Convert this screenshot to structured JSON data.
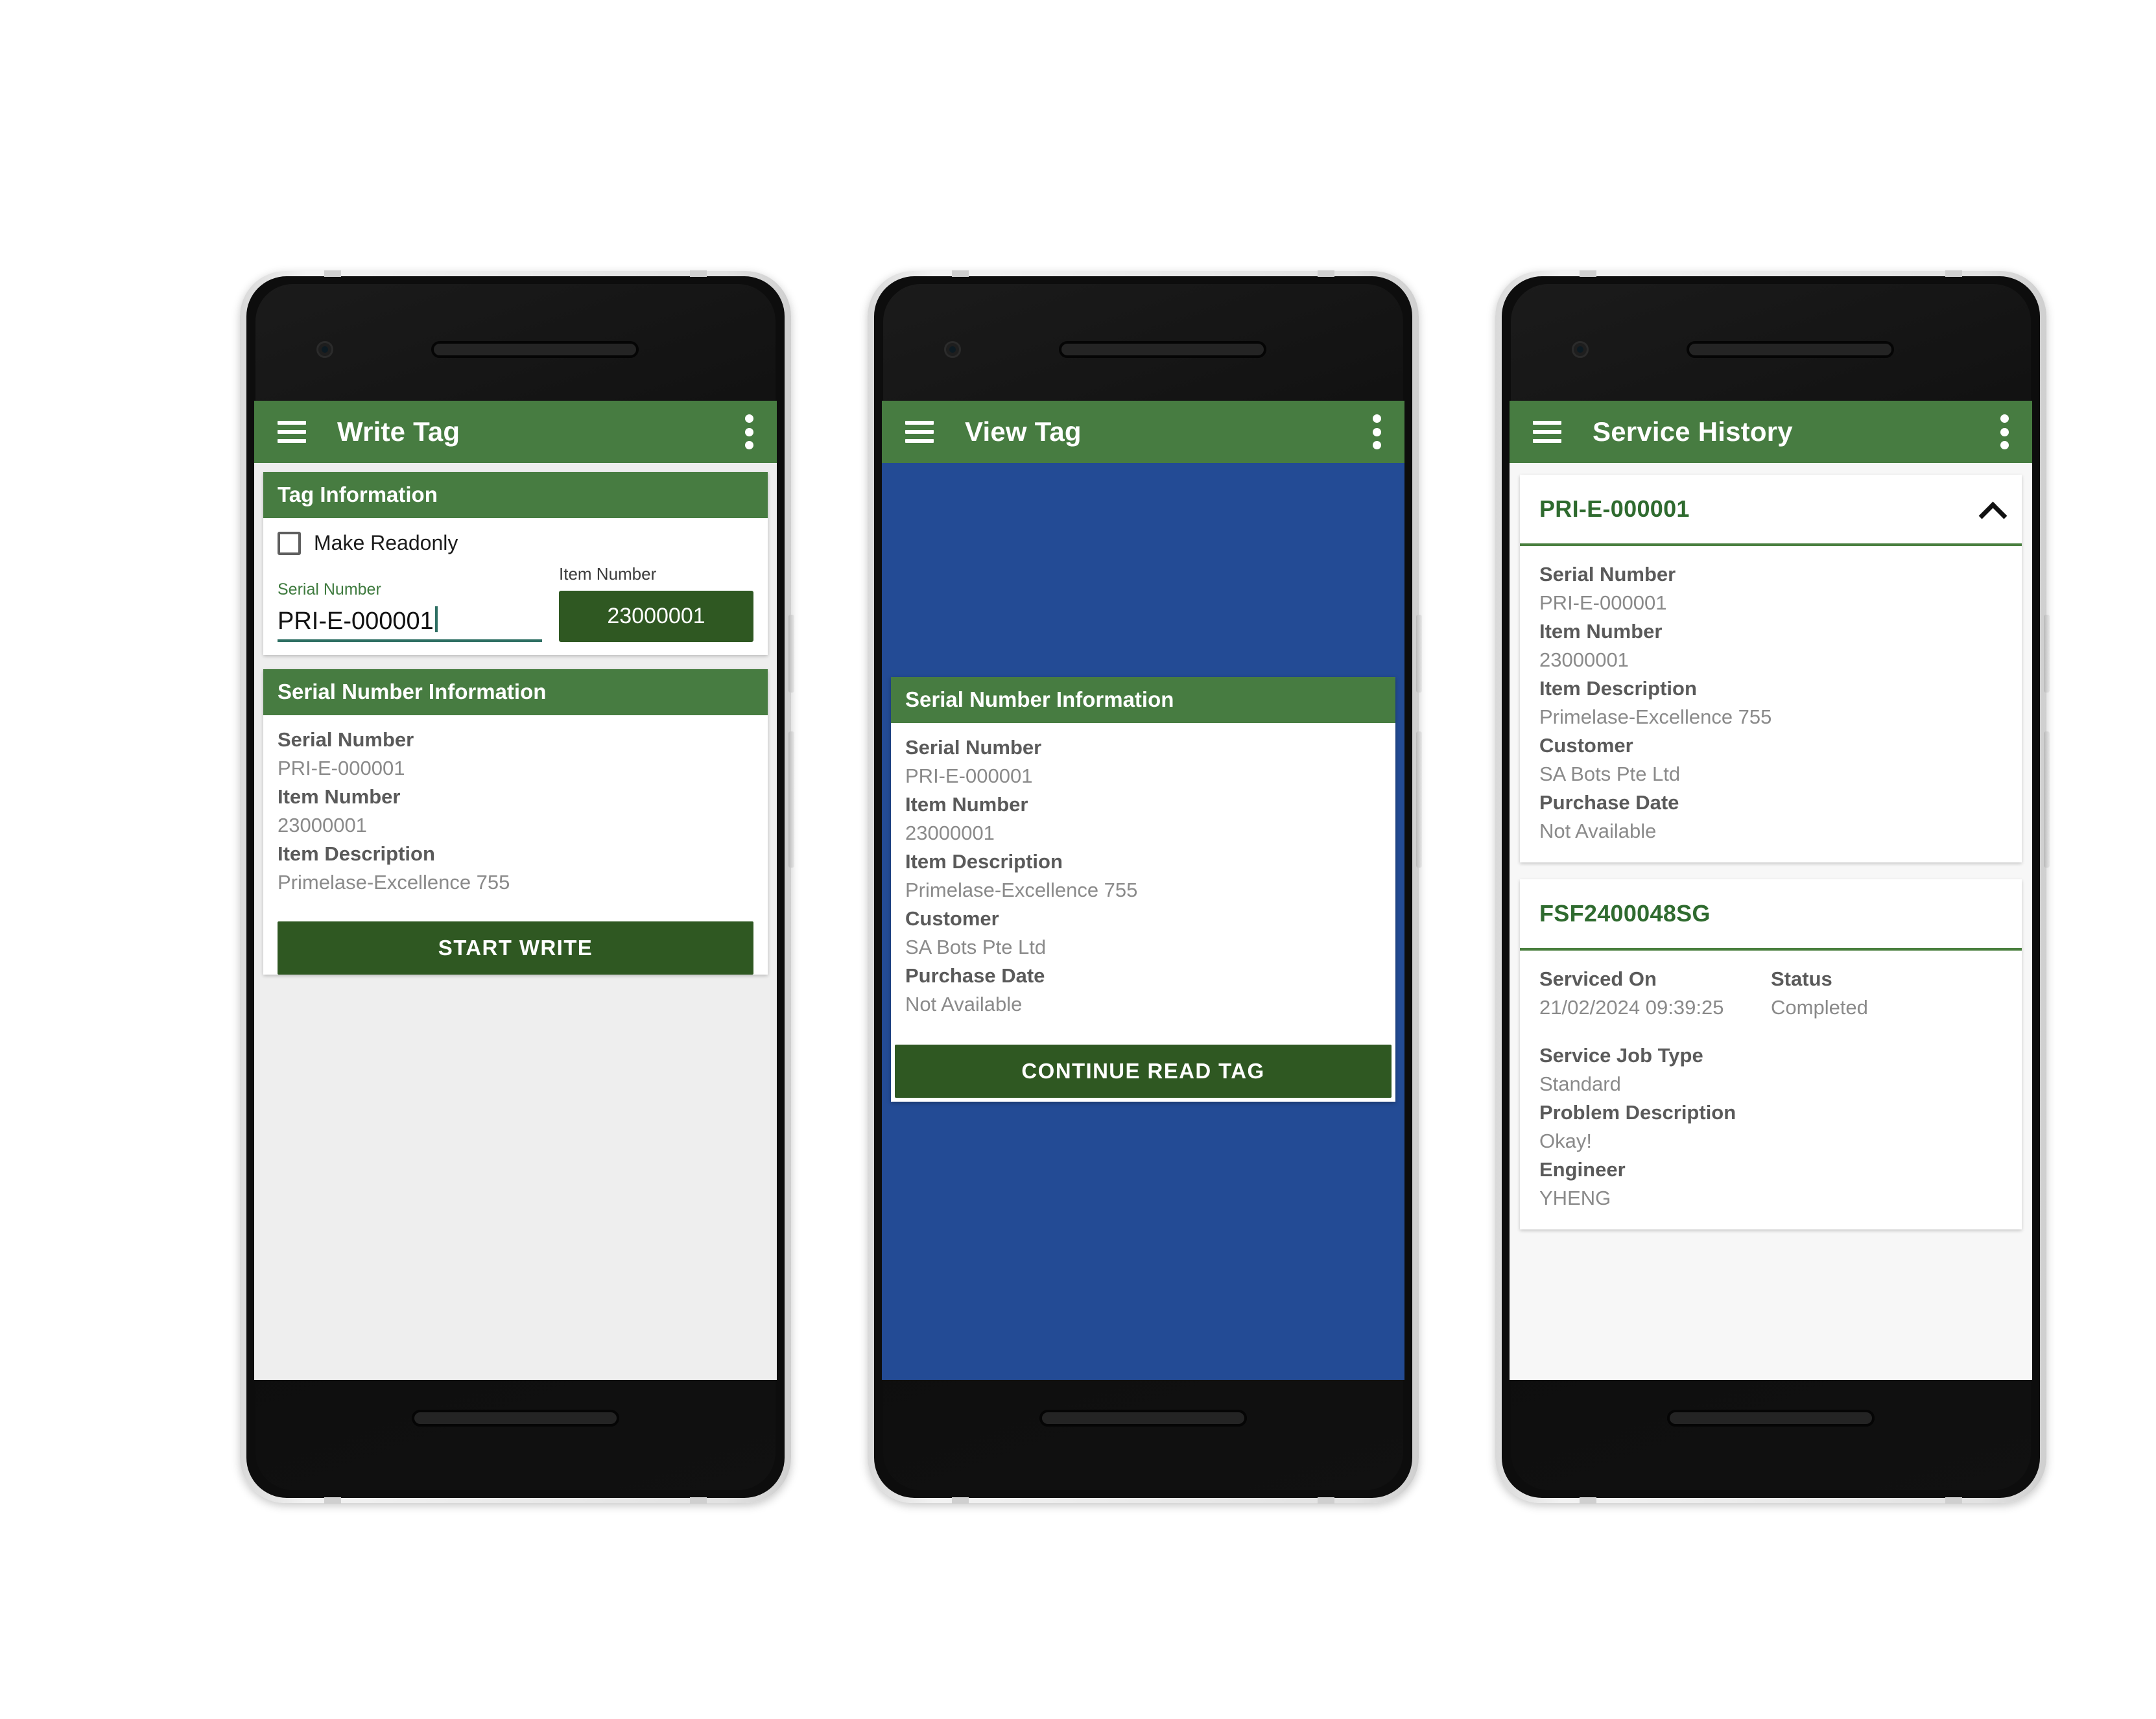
{
  "phones": [
    {
      "id": "write-tag",
      "appbar": {
        "title": "Write Tag",
        "menu_icon": "hamburger-icon",
        "overflow_icon": "kebab-icon"
      },
      "cards": [
        {
          "header": "Tag Information",
          "checkbox_label": "Make Readonly",
          "checkbox_checked": false,
          "serial_field": {
            "label": "Serial Number",
            "value": "PRI-E-000001"
          },
          "item_field": {
            "label": "Item Number",
            "value": "23000001"
          }
        },
        {
          "header": "Serial Number Information",
          "rows": [
            {
              "label": "Serial Number",
              "value": "PRI-E-000001"
            },
            {
              "label": "Item Number",
              "value": "23000001"
            },
            {
              "label": "Item Description",
              "value": "Primelase-Excellence 755"
            }
          ],
          "button": "START WRITE"
        }
      ]
    },
    {
      "id": "view-tag",
      "appbar": {
        "title": "View Tag",
        "menu_icon": "hamburger-icon",
        "overflow_icon": "kebab-icon"
      },
      "background_color": "#234b95",
      "sheet": {
        "header": "Serial Number Information",
        "rows": [
          {
            "label": "Serial Number",
            "value": "PRI-E-000001"
          },
          {
            "label": "Item Number",
            "value": "23000001"
          },
          {
            "label": "Item Description",
            "value": "Primelase-Excellence 755"
          },
          {
            "label": "Customer",
            "value": "SA Bots Pte Ltd"
          },
          {
            "label": "Purchase Date",
            "value": "Not Available"
          }
        ],
        "button": "CONTINUE READ TAG"
      }
    },
    {
      "id": "service-history",
      "appbar": {
        "title": "Service History",
        "menu_icon": "hamburger-icon",
        "overflow_icon": "kebab-icon"
      },
      "serial_card": {
        "title": "PRI-E-000001",
        "expanded": true,
        "chevron_icon": "chevron-up-icon",
        "rows": [
          {
            "label": "Serial Number",
            "value": "PRI-E-000001"
          },
          {
            "label": "Item Number",
            "value": "23000001"
          },
          {
            "label": "Item Description",
            "value": "Primelase-Excellence 755"
          },
          {
            "label": "Customer",
            "value": "SA Bots Pte Ltd"
          },
          {
            "label": "Purchase Date",
            "value": "Not Available"
          }
        ]
      },
      "job_card": {
        "title": "FSF2400048SG",
        "serviced_on_label": "Serviced On",
        "serviced_on_value": "21/02/2024 09:39:25",
        "status_label": "Status",
        "status_value": "Completed",
        "rows": [
          {
            "label": "Service Job Type",
            "value": "Standard"
          },
          {
            "label": "Problem Description",
            "value": "Okay!"
          },
          {
            "label": "Engineer",
            "value": "YHENG"
          }
        ]
      }
    }
  ],
  "colors": {
    "appbar_green": "#477c41",
    "card_header_green": "#477c41",
    "button_green": "#2f5822",
    "accent_blue": "#234b95",
    "page_grey": "#eeeeee",
    "label_grey": "#5a5a5a",
    "value_grey": "#8a8a8a",
    "link_green": "#2f6b2f"
  }
}
